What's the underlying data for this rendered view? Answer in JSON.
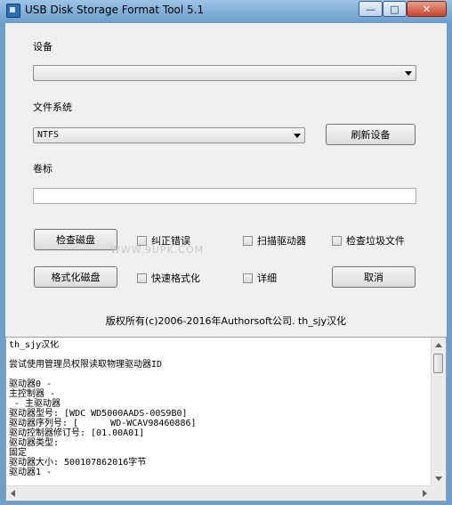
{
  "window": {
    "title": "USB Disk Storage Format Tool 5.1"
  },
  "titlebar_buttons": {
    "minimize": "—",
    "maximize": "□",
    "close": "✕"
  },
  "device": {
    "label": "设备",
    "selected": ""
  },
  "filesystem": {
    "label": "文件系统",
    "selected": "NTFS"
  },
  "refresh_button": "刷新设备",
  "volume": {
    "label": "卷标",
    "value": ""
  },
  "check_disk_button": "检查磁盘",
  "format_disk_button": "格式化磁盘",
  "cancel_button": "取消",
  "options": {
    "correct_errors": "纠正错误",
    "scan_drive": "扫描驱动器",
    "check_junk": "检查垃圾文件",
    "quick_format": "快速格式化",
    "verbose": "详细"
  },
  "watermark": "WWW.9UPK.COM",
  "copyright": "版权所有(c)2006-2016年Authorsoft公司.    th_sjy汉化",
  "log": [
    "th_sjy汉化",
    "",
    "尝试使用管理员权限读取物理驱动器ID",
    "",
    "驱动器0 -",
    "主控制器 -",
    " - 主驱动器",
    "驱动器型号: [WDC WD5000AADS-00S9B0]",
    "驱动器序列号: [      WD-WCAV98460886]",
    "驱动控制器修订号: [01.00A01]",
    "驱动器类型:",
    "固定",
    "驱动器大小: 500107862016字节",
    "驱动器1 -"
  ]
}
